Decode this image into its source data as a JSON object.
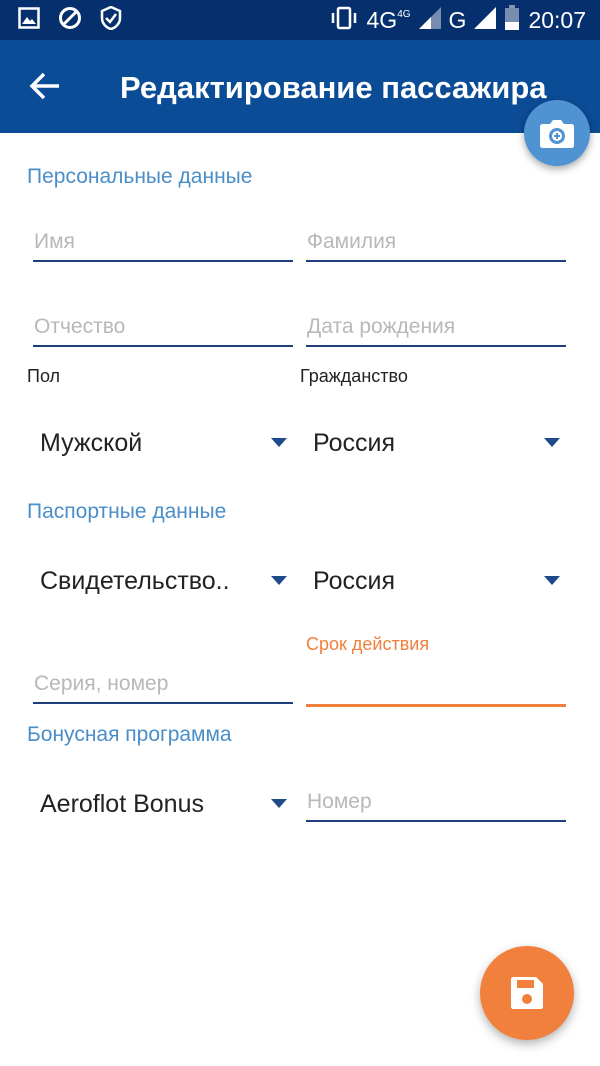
{
  "status_bar": {
    "icons_left": [
      "image-icon",
      "blocked-icon",
      "shield-icon"
    ],
    "network": "4G",
    "network_sup": "4G",
    "network2": "G",
    "time": "20:07"
  },
  "appbar": {
    "title": "Редактирование пассажира",
    "colors": {
      "statusbar": "#06306d",
      "appbar": "#0b4c96",
      "accent": "#f0803c",
      "section": "#4a8ec8"
    }
  },
  "sections": {
    "personal": "Персональные данные",
    "passport": "Паспортные данные",
    "bonus": "Бонусная программа"
  },
  "fields": {
    "first_name": {
      "value": "",
      "placeholder": "Имя"
    },
    "last_name": {
      "value": "",
      "placeholder": "Фамилия"
    },
    "middle_name": {
      "value": "",
      "placeholder": "Отчество"
    },
    "birth_date": {
      "value": "",
      "placeholder": "Дата рождения"
    },
    "doc_number": {
      "value": "",
      "placeholder": "Серия, номер"
    },
    "expiry": {
      "label": "Срок действия",
      "value": ""
    },
    "bonus_number": {
      "value": "",
      "placeholder": "Номер"
    }
  },
  "labels": {
    "gender": "Пол",
    "citizenship": "Гражданство"
  },
  "selects": {
    "gender": "Мужской",
    "citizenship": "Россия",
    "doc_type": "Свидетельство..",
    "doc_country": "Россия",
    "bonus_program": "Aeroflot Bonus"
  }
}
